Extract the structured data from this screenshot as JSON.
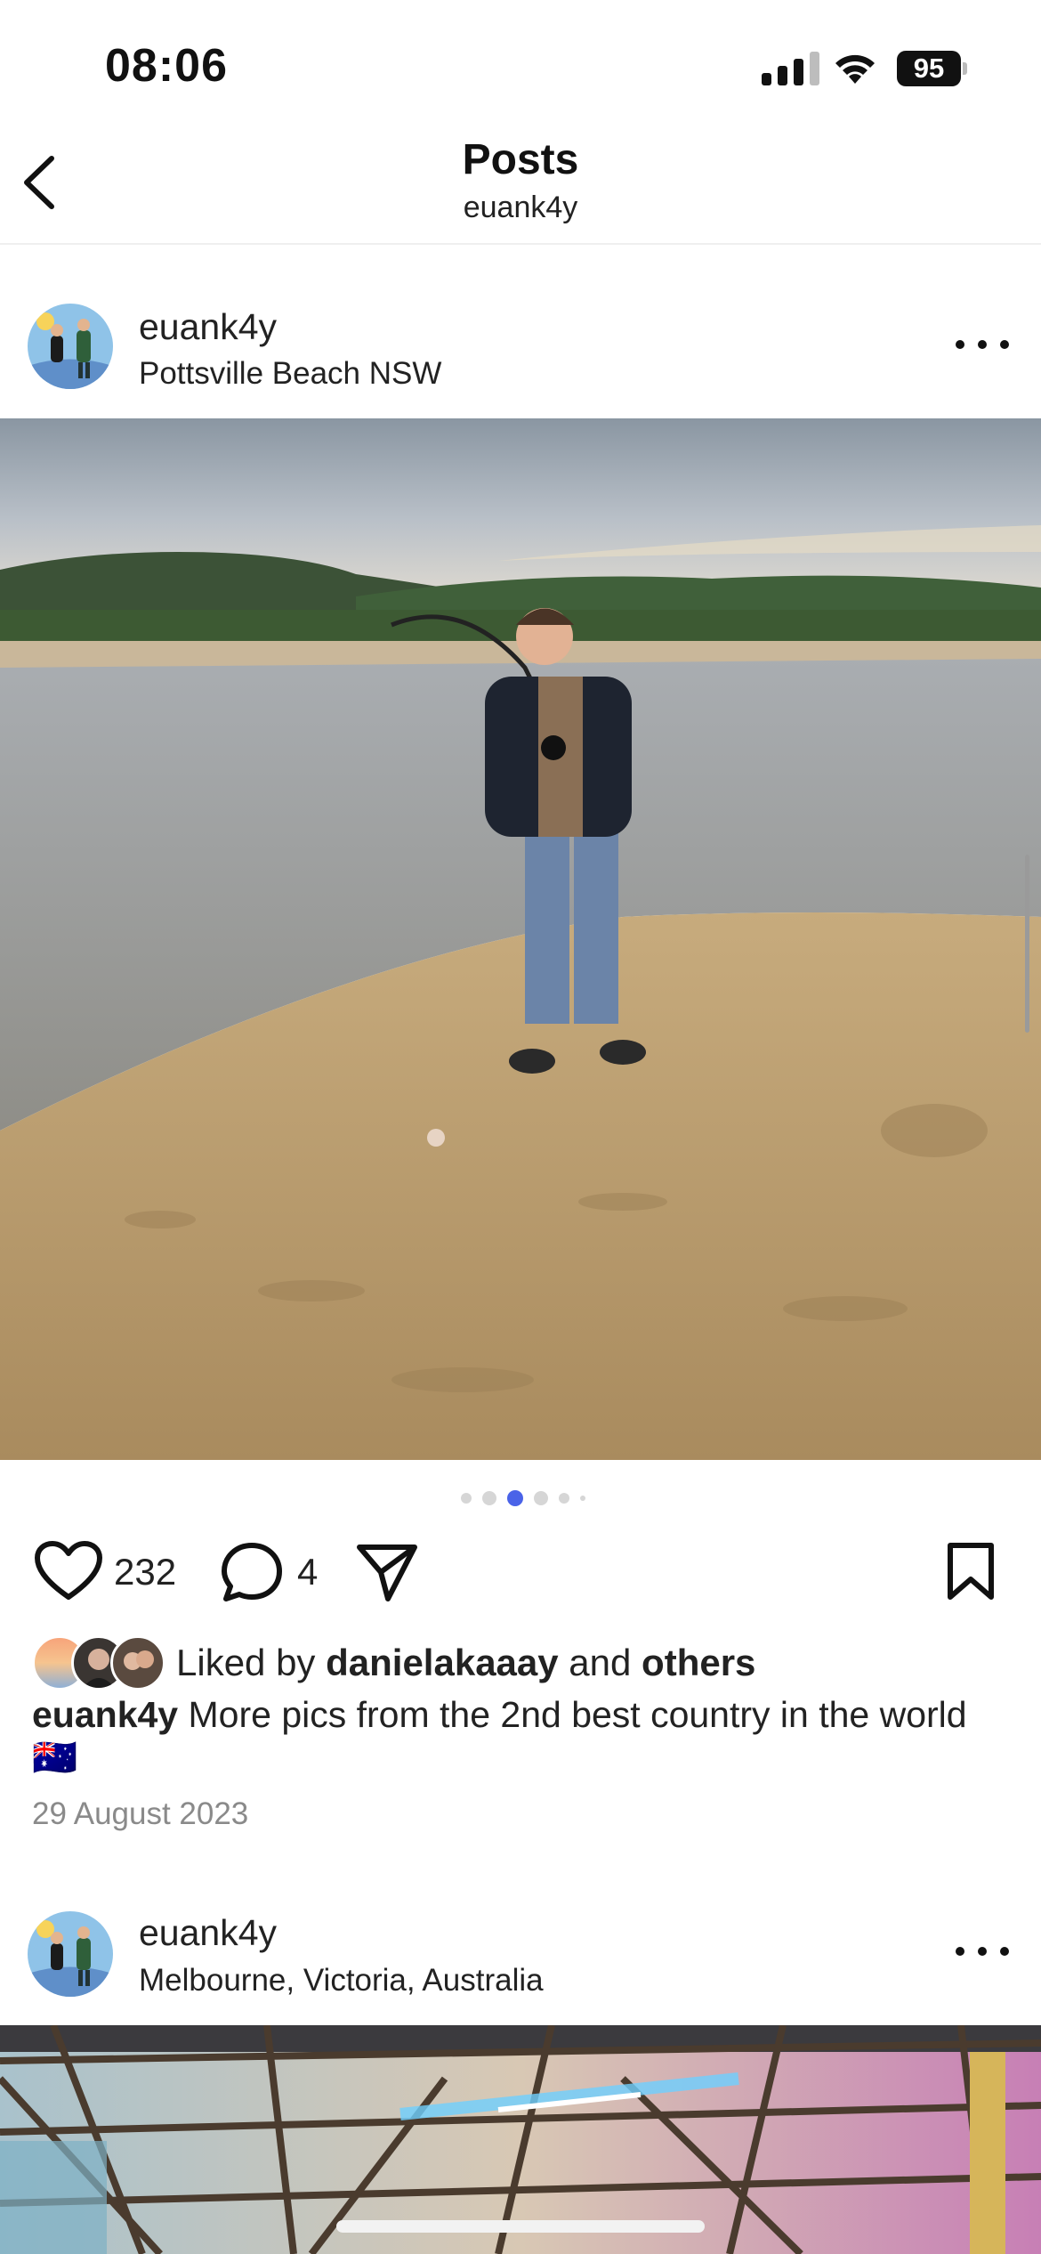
{
  "status_bar": {
    "time": "08:06",
    "battery": "95",
    "icons": [
      "signal-icon",
      "wifi-icon",
      "battery-icon"
    ]
  },
  "nav": {
    "title": "Posts",
    "subtitle": "euank4y",
    "back_icon": "chevron-left-icon"
  },
  "posts": [
    {
      "username": "euank4y",
      "location": "Pottsville Beach NSW",
      "carousel": {
        "total": 6,
        "active": 3
      },
      "likes": "232",
      "comments": "4",
      "liked_by_prefix": "Liked by",
      "liked_by_user": "danielakaaay",
      "liked_by_and": "and",
      "liked_by_others": "others",
      "caption_user": "euank4y",
      "caption_text": "More pics from the 2nd best country in the world 🇦🇺",
      "date": "29 August 2023"
    },
    {
      "username": "euank4y",
      "location": "Melbourne, Victoria, Australia"
    }
  ],
  "colors": {
    "accent_dot": "#4a63e8",
    "text": "#222222",
    "muted": "#8a8a8a"
  }
}
